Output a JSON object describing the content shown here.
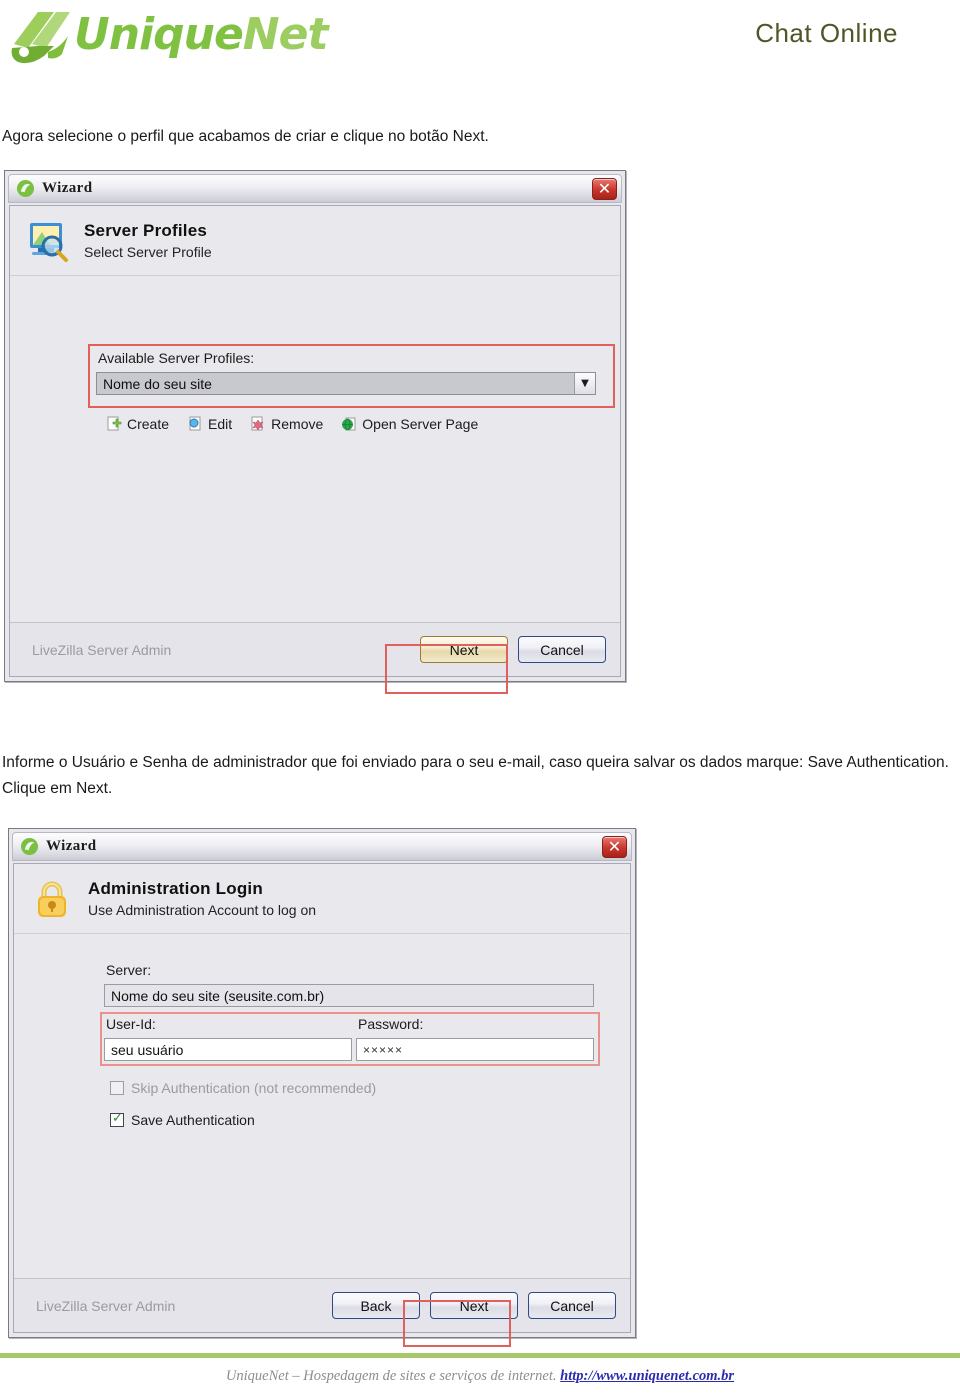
{
  "header": {
    "logo_part1": "Unique",
    "logo_part2": "Net",
    "page_title": "Chat Online",
    "brand_green": "#7fc241",
    "title_color": "#4e5725"
  },
  "instructions": {
    "para1": "Agora selecione o perfil que acabamos de criar e clique no botão Next.",
    "para2": "Informe o Usuário e Senha de administrador que foi enviado para o seu e-mail, caso queira salvar os dados marque: Save Authentication. Clique em Next."
  },
  "dialog1": {
    "title": "Wizard",
    "close_glyph": "✕",
    "header_title": "Server Profiles",
    "header_subtitle": "Select Server Profile",
    "group_label": "Available Server Profiles:",
    "combo_value": "Nome do seu site",
    "combo_arrow": "▼",
    "toolbar": [
      {
        "label": "Create",
        "icon": "create-icon"
      },
      {
        "label": "Edit",
        "icon": "edit-icon"
      },
      {
        "label": "Remove",
        "icon": "remove-icon"
      },
      {
        "label": "Open Server Page",
        "icon": "globe-icon"
      }
    ],
    "footer_label": "LiveZilla Server Admin",
    "buttons": [
      {
        "label": "Next",
        "style": "default"
      },
      {
        "label": "Cancel",
        "style": "normal"
      }
    ]
  },
  "dialog2": {
    "title": "Wizard",
    "close_glyph": "✕",
    "header_title": "Administration Login",
    "header_subtitle": "Use Administration Account to log on",
    "server_label": "Server:",
    "server_value": "Nome do seu site (seusite.com.br)",
    "userid_label": "User-Id:",
    "userid_value": "seu usuário",
    "password_label": "Password:",
    "password_value": "×××××",
    "checkbox_skip": {
      "label": "Skip Authentication (not recommended)",
      "checked": false
    },
    "checkbox_save": {
      "label": "Save Authentication",
      "checked": true
    },
    "footer_label": "LiveZilla Server Admin",
    "buttons": [
      {
        "label": "Back",
        "style": "normal"
      },
      {
        "label": "Next",
        "style": "normal"
      },
      {
        "label": "Cancel",
        "style": "normal"
      }
    ]
  },
  "footer": {
    "text": "UniqueNet – Hospedagem de sites e serviços de internet.",
    "link": "http://www.uniquenet.com.br",
    "rule_color": "#a8c96a"
  }
}
